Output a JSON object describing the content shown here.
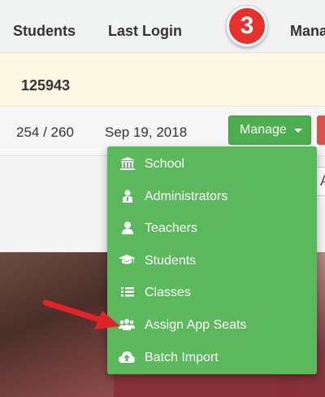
{
  "table": {
    "headers": {
      "students": "Students",
      "last_login": "Last Login",
      "manage": "Mana"
    },
    "group_row": {
      "id": "125943"
    },
    "row": {
      "students": "254 / 260",
      "last_login": "Sep 19, 2018"
    },
    "select_partial": "A"
  },
  "step_badge": "3",
  "manage_button": {
    "label": "Manage"
  },
  "dropdown": {
    "items": [
      {
        "label": "School",
        "icon": "school-icon"
      },
      {
        "label": "Administrators",
        "icon": "administrator-icon"
      },
      {
        "label": "Teachers",
        "icon": "user-icon"
      },
      {
        "label": "Students",
        "icon": "graduation-cap-icon"
      },
      {
        "label": "Classes",
        "icon": "list-icon"
      },
      {
        "label": "Assign App Seats",
        "icon": "users-icon"
      },
      {
        "label": "Batch Import",
        "icon": "cloud-upload-icon"
      }
    ]
  },
  "colors": {
    "menu_green": "#5cb85c",
    "button_green": "#4cae4c",
    "badge_red": "#e8302c",
    "arrow_red": "#e3232a",
    "group_row_bg": "#fcf8e3"
  }
}
